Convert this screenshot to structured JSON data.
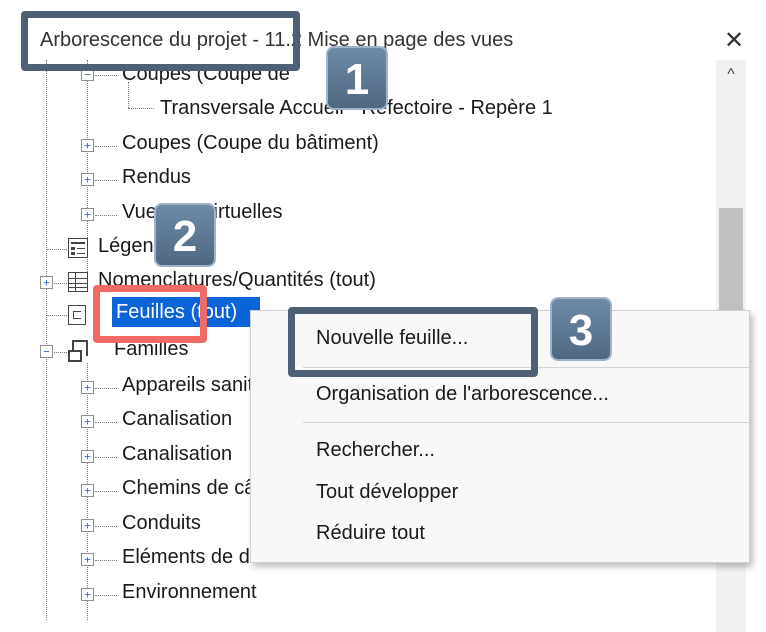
{
  "header": {
    "title": "Arborescence du projet - 11.2 Mise en page des vues",
    "close_icon": "✕",
    "scroll_up_icon": "^"
  },
  "tree": [
    {
      "label": "Coupes (Coupe de"
    },
    {
      "label": "Transversale Accueil - Réfectoire - Repère 1"
    },
    {
      "label": "Coupes (Coupe du bâtiment)"
    },
    {
      "label": "Rendus"
    },
    {
      "label": "Vues 3D virtuelles"
    },
    {
      "label": "Légendes"
    },
    {
      "label": "Nomenclatures/Quantités (tout)"
    },
    {
      "label": "Feuilles (tout)"
    },
    {
      "label": "Familles"
    },
    {
      "label": "Appareils sanitaires"
    },
    {
      "label": "Canalisation"
    },
    {
      "label": "Canalisation"
    },
    {
      "label": "Chemins de câbles"
    },
    {
      "label": "Conduits"
    },
    {
      "label": "Eléments de détail"
    },
    {
      "label": "Environnement"
    }
  ],
  "context_menu": {
    "items": [
      "Nouvelle feuille...",
      "Organisation de l'arborescence...",
      "Rechercher...",
      "Tout développer",
      "Réduire tout"
    ]
  },
  "callouts": [
    "1",
    "2",
    "3"
  ],
  "colors": {
    "selection": "#0a64d6",
    "callout_dark": "#4d6075",
    "callout_red": "#f06a66"
  }
}
